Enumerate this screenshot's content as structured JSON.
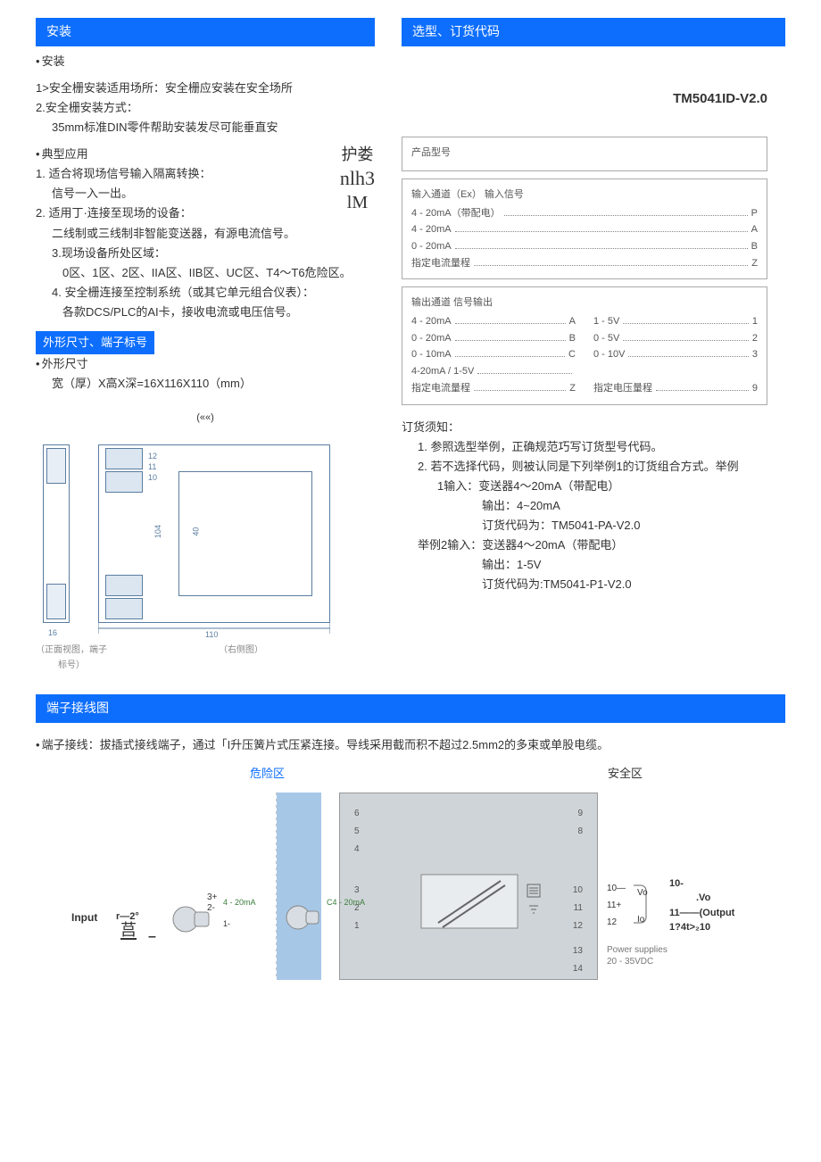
{
  "sections": {
    "install_title": "安装",
    "order_title": "选型、订货代码",
    "dim_title": "外形尺寸、端子标号",
    "wiring_title": "端子接线图"
  },
  "install": {
    "bullet": "安装",
    "line1": "1>安全栅安装适用场所：安全栅应安装在安全场所",
    "line2": "2.安全栅安装方式：",
    "line3": "35mm标准DIN零件帮助安装发尽可能垂直安",
    "app_bullet": "典型应用",
    "app1": "1. 适合将现场信号输入隔离转换：",
    "app1b": "信号一入一出。",
    "app2": "2. 适用丁·连接至现场的设备：",
    "app2b": "二线制或三线制非智能变送器，有源电流信号。",
    "app3": "3.现场设备所处区域：",
    "app3b": "0区、1区、2区、IIA区、IIB区、UC区、T4～T6危险区。",
    "app4": "4. 安全栅连接至控制系统（或其它单元组合仪表）：",
    "app4b": "各款DCS/PLC的AI卡，接收电流或电压信号。",
    "stray1": "护娄",
    "stray2": "nlh3",
    "stray3": "lM"
  },
  "dims": {
    "bullet": "外形尺寸",
    "line": "宽（厚）X高X深=16X116X110（mm）",
    "mark": "(««)",
    "d16": "16",
    "d110": "110",
    "d104": "104",
    "d40": "40",
    "d12": "12",
    "d11": "11",
    "d10": "10",
    "cap_left": "（正面视图，端子标号）",
    "cap_right": "（右侧图）"
  },
  "order": {
    "model": "TM5041ID-V2.0",
    "prod_label": "产品型号",
    "in_header": "输入通道（Ex）   输入信号",
    "in_rows": [
      {
        "label": "4 - 20mA（带配电）",
        "code": "P"
      },
      {
        "label": "4 - 20mA",
        "code": "A"
      },
      {
        "label": "0 - 20mA",
        "code": "B"
      },
      {
        "label": "指定电流量程",
        "code": "Z"
      }
    ],
    "out_header_l": "输出通道   信号输出",
    "out_left": [
      {
        "label": "4 - 20mA",
        "code": "A"
      },
      {
        "label": "0 - 20mA",
        "code": "B"
      },
      {
        "label": "0 - 10mA",
        "code": "C"
      },
      {
        "label": "4-20mA / 1-5V",
        "code": ""
      },
      {
        "label": "指定电流量程",
        "code": "Z"
      }
    ],
    "out_right": [
      {
        "label": "1 - 5V",
        "code": "1"
      },
      {
        "label": "0 - 5V",
        "code": "2"
      },
      {
        "label": "0 - 10V",
        "code": "3"
      },
      {
        "label": "",
        "code": ""
      },
      {
        "label": "指定电压量程",
        "code": "9"
      }
    ],
    "notice_title": "订货须知：",
    "notice1": "1. 参照选型举例，正确规范巧写订货型号代码。",
    "notice2": "2. 若不选择代码，则被认同是下列举例1的订货组合方式。举例",
    "ex1a": "1输入：变送器4～20mA（带配电）",
    "ex1b": "输出：4~20mA",
    "ex1c": "订货代码为：TM5041-PA-V2.0",
    "ex2a": "举例2输入：变送器4～20mA（带配电）",
    "ex2b": "输出：1-5V",
    "ex2c": "订货代码为:TM5041-P1-V2.0"
  },
  "wiring": {
    "bullet": "端子接线：拔插式接线端子，通过「I升压簧片式压紧连接。导线采用截而积不超过2.5mm2的多束或单股电缆。",
    "hazard": "危险区",
    "safe": "安全区",
    "input": "Input",
    "r2": "r—2°",
    "ying": "莒",
    "dash": "–",
    "c420": "C4 - 20mA",
    "t1": "1",
    "t2": "2",
    "t3": "3",
    "t4": "4",
    "t5": "5",
    "t6": "6",
    "t8": "8",
    "t9": "9",
    "t10": "10",
    "t11": "11",
    "t12": "12",
    "t13": "13",
    "t14": "14",
    "pwr": "Power supplies",
    "pwrv": "20 - 35VDC",
    "vo": "Vo",
    "io": "Io",
    "r10": "10-",
    "r10b": ".Vo",
    "r11": "11——(Output",
    "r12": "1?4t>₂10",
    "p3": "3+",
    "p2": "2-",
    "p420": "4 - 20mA",
    "p1": "1-",
    "rt10": "10—",
    "rt11": "11+",
    "rt12": "12"
  }
}
